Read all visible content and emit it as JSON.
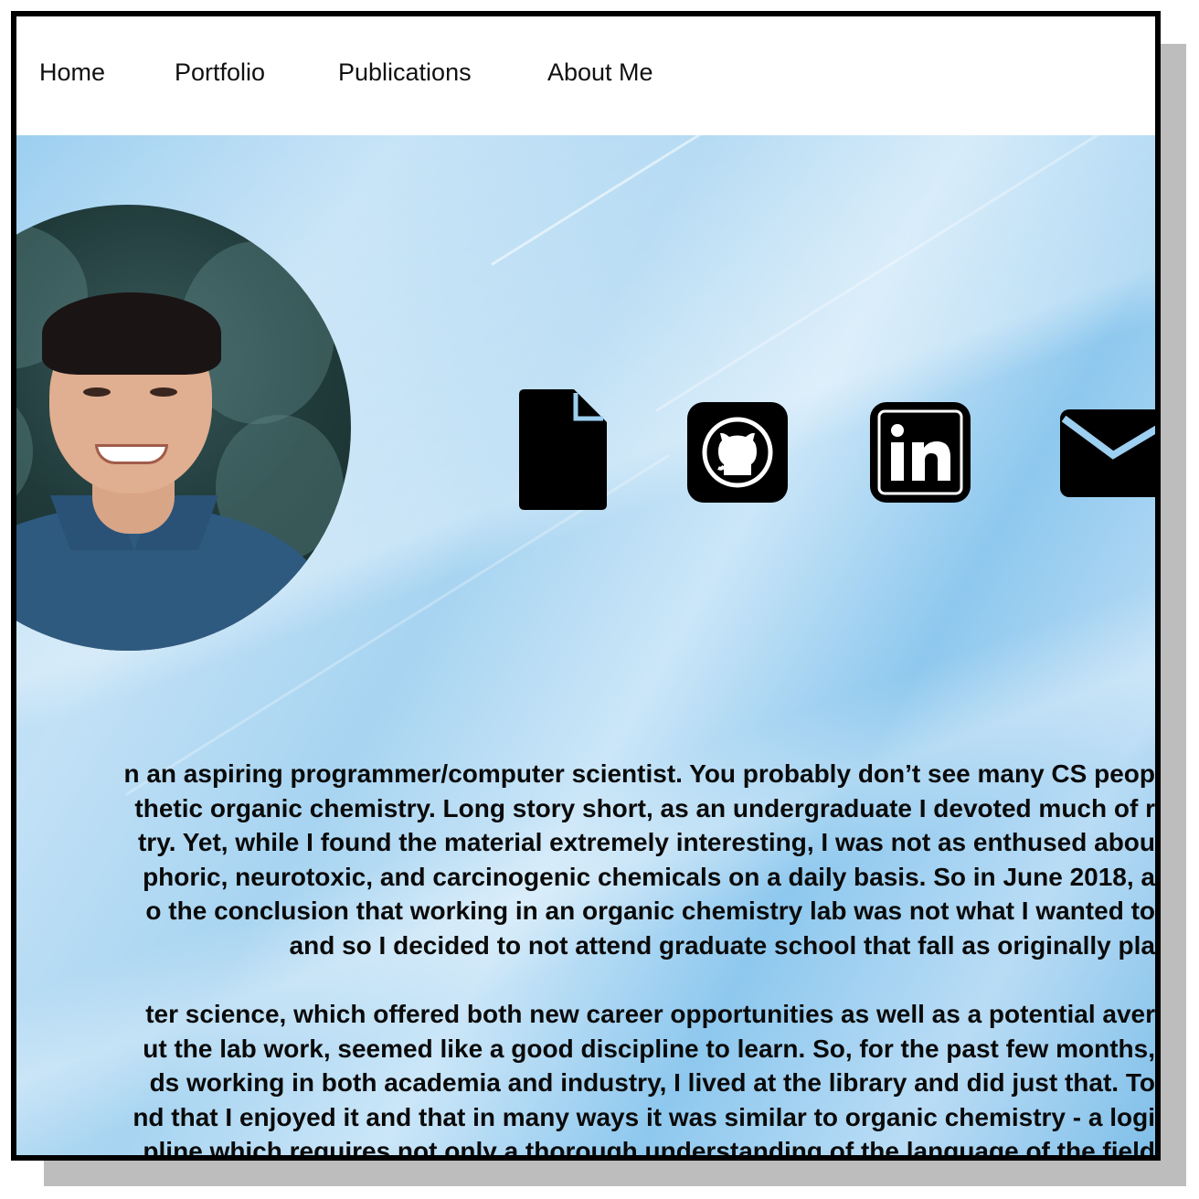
{
  "nav": {
    "items": [
      {
        "label": "Home"
      },
      {
        "label": "Portfolio"
      },
      {
        "label": "Publications"
      },
      {
        "label": "About Me"
      }
    ]
  },
  "hero": {
    "avatar_alt": "profile photo",
    "icons": [
      {
        "name": "document-icon",
        "meaning": "resume"
      },
      {
        "name": "github-icon",
        "meaning": "GitHub"
      },
      {
        "name": "linkedin-icon",
        "meaning": "LinkedIn"
      },
      {
        "name": "envelope-icon",
        "meaning": "email"
      }
    ],
    "linkedin_text": "in"
  },
  "bio": {
    "paragraph1": [
      "n an aspiring programmer/computer scientist. You probably don’t see many CS peop",
      "thetic organic chemistry. Long story short, as an undergraduate I devoted much of r",
      "try. Yet, while I found the material extremely interesting, I was not as enthused abou",
      "phoric, neurotoxic, and carcinogenic chemicals on a daily basis. So in June 2018, a",
      "o the conclusion that working in an organic chemistry lab was not what I wanted to",
      "and so I decided to not attend graduate school that fall as originally pla"
    ],
    "paragraph2": [
      "ter science, which offered both new career opportunities as well as a potential aver",
      "ut the lab work, seemed like a good discipline to learn. So, for the past few months,",
      "ds working in both academia and industry, I lived at the library and did just that. To",
      "nd that I enjoyed it and that in many ways it was similar to organic chemistry - a logi",
      "pline which requires not only a thorough understanding of the language of the field"
    ]
  },
  "colors": {
    "background_blue": "#9ccff0",
    "text": "#0a0a0a",
    "frame": "#000000",
    "shadow": "#bdbdbd"
  }
}
